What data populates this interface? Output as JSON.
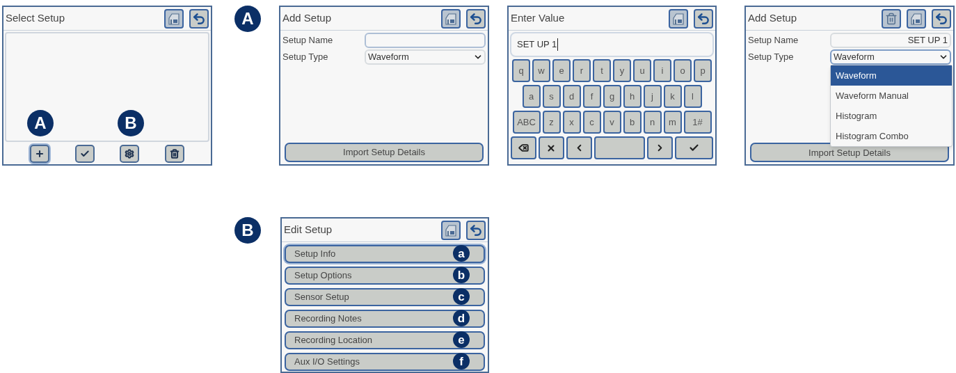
{
  "select_setup": {
    "title": "Select Setup",
    "toolbar": [
      {
        "kind": "add",
        "selected": true,
        "callout": "A"
      },
      {
        "kind": "check",
        "selected": false
      },
      {
        "kind": "settings",
        "selected": false,
        "callout": "B"
      },
      {
        "kind": "delete",
        "selected": false
      }
    ]
  },
  "section_a": {
    "badge": "A"
  },
  "add_setup": {
    "title": "Add Setup",
    "name_label": "Setup Name",
    "type_label": "Setup Type",
    "type_value": "Waveform",
    "button": "Import Setup Details"
  },
  "enter_value": {
    "title": "Enter Value",
    "value": "SET UP 1",
    "rows": [
      [
        "q",
        "w",
        "e",
        "r",
        "t",
        "y",
        "u",
        "i",
        "o",
        "p"
      ],
      [
        "a",
        "s",
        "d",
        "f",
        "g",
        "h",
        "j",
        "k",
        "l"
      ],
      [
        "ABC",
        "z",
        "x",
        "c",
        "v",
        "b",
        "n",
        "m",
        "1#"
      ]
    ]
  },
  "add_setup_open": {
    "title": "Add Setup",
    "name_label": "Setup Name",
    "name_value": "SET UP 1",
    "type_label": "Setup Type",
    "type_value": "Waveform",
    "button": "Import Setup Details",
    "options": [
      {
        "label": "Waveform",
        "selected": true
      },
      {
        "label": "Waveform Manual",
        "selected": false
      },
      {
        "label": "Histogram",
        "selected": false
      },
      {
        "label": "Histogram Combo",
        "selected": false
      }
    ]
  },
  "edit_setup": {
    "badge": "B",
    "title": "Edit Setup",
    "items": [
      {
        "label": "Setup Info",
        "callout": "a",
        "selected": true
      },
      {
        "label": "Setup Options",
        "callout": "b",
        "selected": false
      },
      {
        "label": "Sensor Setup",
        "callout": "c",
        "selected": false
      },
      {
        "label": "Recording Notes",
        "callout": "d",
        "selected": false
      },
      {
        "label": "Recording Location",
        "callout": "e",
        "selected": false
      },
      {
        "label": "Aux I/O Settings",
        "callout": "f",
        "selected": false
      }
    ]
  }
}
